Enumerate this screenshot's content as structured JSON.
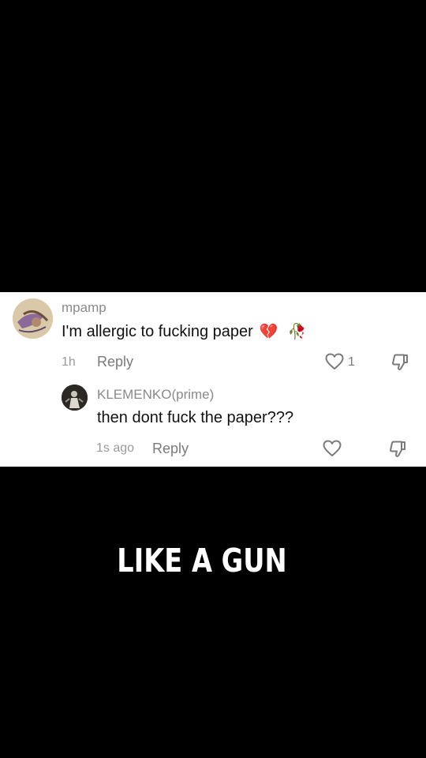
{
  "comment": {
    "username": "mpamp",
    "text": "I'm allergic to fucking paper",
    "emoji_1": "💔",
    "emoji_2": "🥀",
    "time": "1h",
    "reply_label": "Reply",
    "like_count": "1"
  },
  "reply": {
    "username": "KLEMENKO(prime)",
    "text": "then dont fuck the paper???",
    "time": "1s ago",
    "reply_label": "Reply"
  },
  "caption": "LIKE A GUN",
  "icons": [
    "heart-icon",
    "dislike-icon"
  ],
  "colors": {
    "background": "#000000",
    "panel": "#ffffff",
    "username": "#8a8a8a",
    "caption": "#ffffff"
  }
}
